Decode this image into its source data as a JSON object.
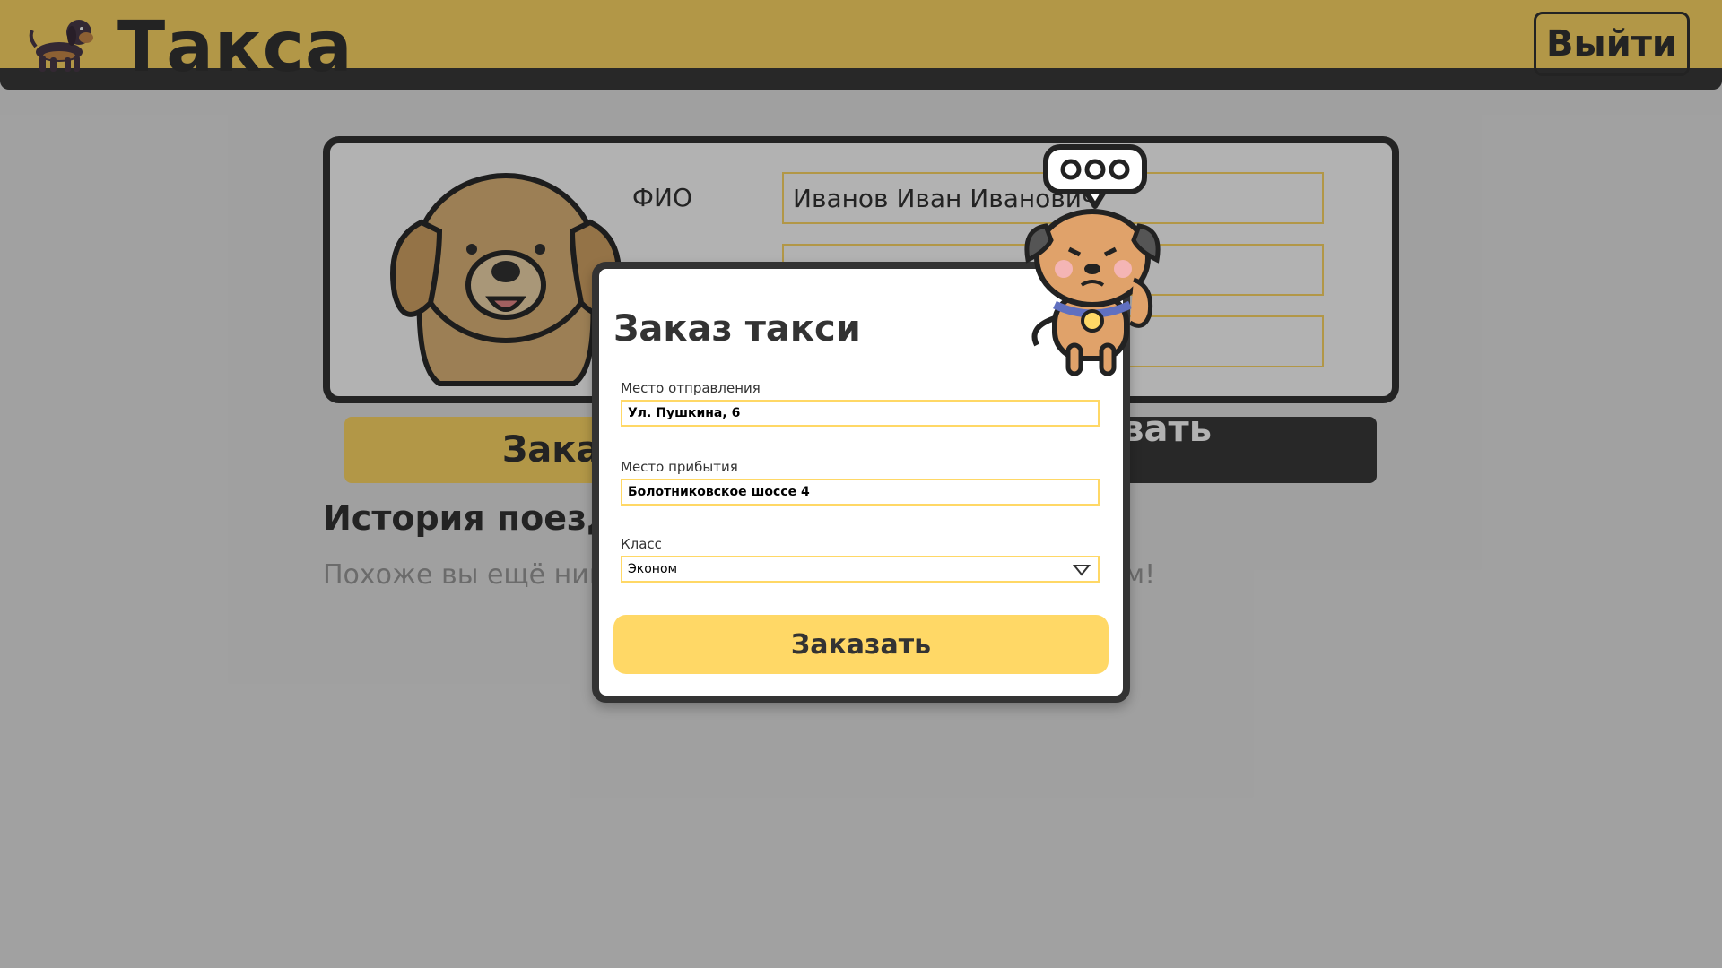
{
  "header": {
    "logo_icon": "dachshund-icon",
    "app_title": "Такса",
    "logout_label": "Выйти",
    "colors": {
      "accent": "#ffd866",
      "dark": "#3a3a3a"
    }
  },
  "profile": {
    "avatar_icon": "dog-avatar-icon",
    "fio_label": "ФИО",
    "fio_value": "Иванов Иван Иванович"
  },
  "actions": {
    "order_label": "Заказать",
    "edit_profile_label": "Редактировать профиль"
  },
  "history": {
    "title": "История поездок",
    "empty_text": "Похоже вы ещё никуда не ездили, давайте это исправим!"
  },
  "modal": {
    "title": "Заказ такси",
    "departure_label": "Место отправления",
    "departure_value": "Ул. Пушкина, 6",
    "arrival_label": "Место прибытия",
    "arrival_value": "Болотниковское шоссе 4",
    "class_label": "Класс",
    "class_value": "Эконом",
    "submit_label": "Заказать",
    "mascot_icon": "thinking-dog-icon"
  }
}
